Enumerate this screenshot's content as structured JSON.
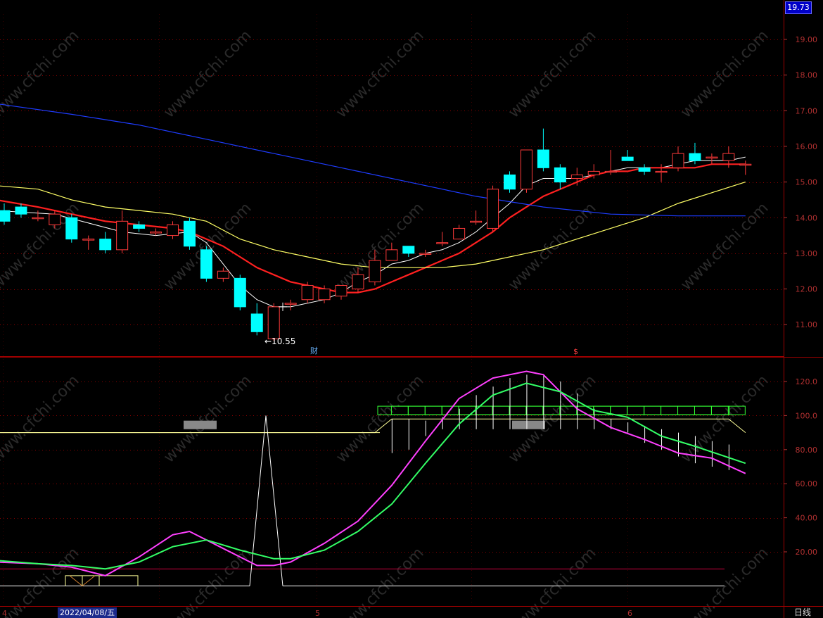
{
  "header": {
    "last_price": "19.73"
  },
  "footer": {
    "period": "日线"
  },
  "colors": {
    "grid": "#8b0000",
    "axis_label": "#b03030",
    "up": "#ff3a3a",
    "down": "#00ffff",
    "ma5": "#ffffff",
    "ma10": "#ff2020",
    "ma20": "#ffff66",
    "ma60": "#1e3cff",
    "k_line": "#ff40ff",
    "d_line": "#33ff66",
    "band": "#ffff99"
  },
  "watermark": "www.cfchi.com",
  "chart_data": [
    {
      "type": "candlestick",
      "yaxis": {
        "ticks": [
          "19.00",
          "18.00",
          "17.00",
          "16.00",
          "15.00",
          "14.00",
          "13.00",
          "12.00",
          "11.00"
        ],
        "range": [
          10.3,
          19.9
        ]
      },
      "candles": [
        {
          "o": 14.2,
          "c": 13.9,
          "h": 14.4,
          "l": 13.8
        },
        {
          "o": 14.3,
          "c": 14.1,
          "h": 14.4,
          "l": 14.0
        },
        {
          "o": 14.0,
          "c": 14.0,
          "h": 14.2,
          "l": 13.9
        },
        {
          "o": 13.8,
          "c": 14.1,
          "h": 14.2,
          "l": 13.7
        },
        {
          "o": 14.0,
          "c": 13.4,
          "h": 14.1,
          "l": 13.3
        },
        {
          "o": 13.4,
          "c": 13.4,
          "h": 13.5,
          "l": 13.1
        },
        {
          "o": 13.4,
          "c": 13.1,
          "h": 13.6,
          "l": 13.0
        },
        {
          "o": 13.1,
          "c": 13.9,
          "h": 14.2,
          "l": 13.0
        },
        {
          "o": 13.8,
          "c": 13.7,
          "h": 13.9,
          "l": 13.6
        },
        {
          "o": 13.6,
          "c": 13.6,
          "h": 13.7,
          "l": 13.5
        },
        {
          "o": 13.5,
          "c": 13.8,
          "h": 13.9,
          "l": 13.4
        },
        {
          "o": 13.9,
          "c": 13.2,
          "h": 14.0,
          "l": 13.1
        },
        {
          "o": 13.1,
          "c": 12.3,
          "h": 13.2,
          "l": 12.2
        },
        {
          "o": 12.3,
          "c": 12.5,
          "h": 12.6,
          "l": 12.2
        },
        {
          "o": 12.3,
          "c": 11.5,
          "h": 12.4,
          "l": 11.4
        },
        {
          "o": 11.3,
          "c": 10.8,
          "h": 11.6,
          "l": 10.7
        },
        {
          "o": 10.6,
          "c": 11.5,
          "h": 11.6,
          "l": 10.55
        },
        {
          "o": 11.6,
          "c": 11.6,
          "h": 11.7,
          "l": 11.4
        },
        {
          "o": 11.7,
          "c": 12.1,
          "h": 12.2,
          "l": 11.6
        },
        {
          "o": 11.7,
          "c": 12.0,
          "h": 12.1,
          "l": 11.6
        },
        {
          "o": 11.8,
          "c": 12.1,
          "h": 12.1,
          "l": 11.7
        },
        {
          "o": 12.0,
          "c": 12.4,
          "h": 12.6,
          "l": 11.9
        },
        {
          "o": 12.2,
          "c": 12.8,
          "h": 13.1,
          "l": 12.1
        },
        {
          "o": 12.8,
          "c": 13.1,
          "h": 13.3,
          "l": 12.8
        },
        {
          "o": 13.2,
          "c": 13.0,
          "h": 13.2,
          "l": 12.9
        },
        {
          "o": 13.0,
          "c": 13.0,
          "h": 13.1,
          "l": 12.9
        },
        {
          "o": 13.3,
          "c": 13.3,
          "h": 13.6,
          "l": 13.2
        },
        {
          "o": 13.4,
          "c": 13.7,
          "h": 13.8,
          "l": 13.4
        },
        {
          "o": 13.9,
          "c": 13.9,
          "h": 14.2,
          "l": 13.8
        },
        {
          "o": 13.7,
          "c": 14.8,
          "h": 14.9,
          "l": 13.6
        },
        {
          "o": 15.2,
          "c": 14.8,
          "h": 15.3,
          "l": 14.7
        },
        {
          "o": 14.8,
          "c": 15.9,
          "h": 15.9,
          "l": 14.7
        },
        {
          "o": 15.9,
          "c": 15.4,
          "h": 16.5,
          "l": 15.3
        },
        {
          "o": 15.4,
          "c": 15.0,
          "h": 15.5,
          "l": 14.8
        },
        {
          "o": 15.1,
          "c": 15.2,
          "h": 15.4,
          "l": 14.9
        },
        {
          "o": 15.2,
          "c": 15.3,
          "h": 15.5,
          "l": 15.1
        },
        {
          "o": 15.3,
          "c": 15.3,
          "h": 15.9,
          "l": 15.2
        },
        {
          "o": 15.7,
          "c": 15.6,
          "h": 15.9,
          "l": 15.6
        },
        {
          "o": 15.4,
          "c": 15.3,
          "h": 15.5,
          "l": 15.2
        },
        {
          "o": 15.3,
          "c": 15.3,
          "h": 15.5,
          "l": 15.0
        },
        {
          "o": 15.4,
          "c": 15.8,
          "h": 16.0,
          "l": 15.3
        },
        {
          "o": 15.8,
          "c": 15.6,
          "h": 16.1,
          "l": 15.5
        },
        {
          "o": 15.7,
          "c": 15.7,
          "h": 15.8,
          "l": 15.5
        },
        {
          "o": 15.6,
          "c": 15.8,
          "h": 16.0,
          "l": 15.4
        },
        {
          "o": 15.5,
          "c": 15.5,
          "h": 15.6,
          "l": 15.2
        }
      ],
      "ma_series": [
        {
          "color_key": "ma5",
          "points": [
            [
              -0.5,
              14.2
            ],
            [
              3,
              14.1
            ],
            [
              7,
              13.6
            ],
            [
              9,
              13.5
            ],
            [
              11,
              13.6
            ],
            [
              12,
              13.3
            ],
            [
              13,
              12.7
            ],
            [
              14,
              12.1
            ],
            [
              15,
              11.7
            ],
            [
              16,
              11.5
            ],
            [
              17,
              11.5
            ],
            [
              18,
              11.6
            ],
            [
              19,
              11.7
            ],
            [
              20,
              11.9
            ],
            [
              21,
              12.2
            ],
            [
              22,
              12.4
            ],
            [
              23,
              12.7
            ],
            [
              24,
              12.8
            ],
            [
              25,
              13.0
            ],
            [
              26,
              13.1
            ],
            [
              27,
              13.3
            ],
            [
              28,
              13.6
            ],
            [
              29,
              14.0
            ],
            [
              30,
              14.4
            ],
            [
              31,
              14.9
            ],
            [
              32,
              15.1
            ],
            [
              33,
              15.1
            ],
            [
              34,
              15.1
            ],
            [
              35,
              15.2
            ],
            [
              36,
              15.3
            ],
            [
              37,
              15.4
            ],
            [
              38,
              15.4
            ],
            [
              39,
              15.4
            ],
            [
              40,
              15.5
            ],
            [
              41,
              15.6
            ],
            [
              42,
              15.6
            ],
            [
              43,
              15.6
            ],
            [
              44,
              15.7
            ]
          ]
        },
        {
          "color_key": "ma10",
          "points": [
            [
              -0.5,
              14.5
            ],
            [
              2,
              14.3
            ],
            [
              4,
              14.1
            ],
            [
              6,
              13.9
            ],
            [
              8,
              13.8
            ],
            [
              10,
              13.7
            ],
            [
              11,
              13.6
            ],
            [
              12,
              13.4
            ],
            [
              13,
              13.2
            ],
            [
              14,
              12.9
            ],
            [
              15,
              12.6
            ],
            [
              16,
              12.4
            ],
            [
              17,
              12.2
            ],
            [
              18,
              12.1
            ],
            [
              19,
              12.0
            ],
            [
              20,
              11.9
            ],
            [
              21,
              11.9
            ],
            [
              22,
              12.0
            ],
            [
              23,
              12.2
            ],
            [
              24,
              12.4
            ],
            [
              25,
              12.6
            ],
            [
              26,
              12.8
            ],
            [
              27,
              13.0
            ],
            [
              28,
              13.3
            ],
            [
              29,
              13.6
            ],
            [
              30,
              14.0
            ],
            [
              31,
              14.3
            ],
            [
              32,
              14.6
            ],
            [
              33,
              14.8
            ],
            [
              34,
              15.0
            ],
            [
              35,
              15.2
            ],
            [
              36,
              15.3
            ],
            [
              37,
              15.3
            ],
            [
              38,
              15.4
            ],
            [
              39,
              15.4
            ],
            [
              40,
              15.4
            ],
            [
              41,
              15.4
            ],
            [
              42,
              15.5
            ],
            [
              43,
              15.5
            ],
            [
              44,
              15.5
            ]
          ]
        },
        {
          "color_key": "ma20",
          "points": [
            [
              -0.5,
              14.9
            ],
            [
              2,
              14.8
            ],
            [
              4,
              14.5
            ],
            [
              6,
              14.3
            ],
            [
              8,
              14.2
            ],
            [
              10,
              14.1
            ],
            [
              12,
              13.9
            ],
            [
              14,
              13.4
            ],
            [
              16,
              13.1
            ],
            [
              18,
              12.9
            ],
            [
              20,
              12.7
            ],
            [
              22,
              12.6
            ],
            [
              24,
              12.6
            ],
            [
              26,
              12.6
            ],
            [
              28,
              12.7
            ],
            [
              30,
              12.9
            ],
            [
              32,
              13.1
            ],
            [
              34,
              13.4
            ],
            [
              36,
              13.7
            ],
            [
              38,
              14.0
            ],
            [
              40,
              14.4
            ],
            [
              42,
              14.7
            ],
            [
              44,
              15.0
            ]
          ]
        },
        {
          "color_key": "ma60",
          "points": [
            [
              -0.5,
              17.2
            ],
            [
              4,
              16.9
            ],
            [
              8,
              16.6
            ],
            [
              12,
              16.2
            ],
            [
              16,
              15.8
            ],
            [
              20,
              15.4
            ],
            [
              24,
              15.0
            ],
            [
              28,
              14.6
            ],
            [
              32,
              14.3
            ],
            [
              36,
              14.1
            ],
            [
              40,
              14.05
            ],
            [
              44,
              14.05
            ]
          ]
        }
      ],
      "annotations": {
        "low_label": "←10.55",
        "marker_cai": "财",
        "marker_s": "$"
      }
    },
    {
      "type": "line",
      "yaxis": {
        "ticks": [
          "120.0",
          "100.0",
          "80.00",
          "60.00",
          "40.00",
          "20.00"
        ],
        "range": [
          -5,
          132
        ]
      },
      "series": [
        {
          "color_key": "k_line",
          "points": [
            [
              -0.5,
              14
            ],
            [
              2,
              13
            ],
            [
              4,
              11
            ],
            [
              6,
              6
            ],
            [
              8,
              17
            ],
            [
              10,
              30
            ],
            [
              11,
              32
            ],
            [
              13,
              22
            ],
            [
              15,
              12
            ],
            [
              16,
              12
            ],
            [
              17,
              14
            ],
            [
              19,
              25
            ],
            [
              21,
              38
            ],
            [
              23,
              59
            ],
            [
              25,
              85
            ],
            [
              27,
              110
            ],
            [
              29,
              122
            ],
            [
              31,
              126
            ],
            [
              32,
              124
            ],
            [
              34,
              104
            ],
            [
              36,
              93
            ],
            [
              38,
              86
            ],
            [
              39,
              82
            ],
            [
              40,
              78
            ],
            [
              42,
              75
            ],
            [
              44,
              66
            ]
          ]
        },
        {
          "color_key": "d_line",
          "points": [
            [
              -0.5,
              15
            ],
            [
              2,
              13
            ],
            [
              4,
              12
            ],
            [
              6,
              10
            ],
            [
              8,
              14
            ],
            [
              10,
              23
            ],
            [
              12,
              27
            ],
            [
              14,
              21
            ],
            [
              16,
              16
            ],
            [
              17,
              16
            ],
            [
              19,
              21
            ],
            [
              21,
              32
            ],
            [
              23,
              48
            ],
            [
              25,
              72
            ],
            [
              27,
              95
            ],
            [
              29,
              112
            ],
            [
              31,
              119
            ],
            [
              33,
              114
            ],
            [
              35,
              103
            ],
            [
              37,
              99
            ],
            [
              39,
              88
            ],
            [
              41,
              82
            ],
            [
              44,
              72
            ]
          ]
        }
      ],
      "level_lines": [
        {
          "y": 90
        },
        {
          "y": 10
        },
        {
          "y": 0
        }
      ],
      "band_upper": [
        [
          -0.5,
          90
        ],
        [
          22,
          90
        ],
        [
          23,
          98
        ],
        [
          43,
          98
        ],
        [
          44,
          90
        ]
      ]
    }
  ]
}
